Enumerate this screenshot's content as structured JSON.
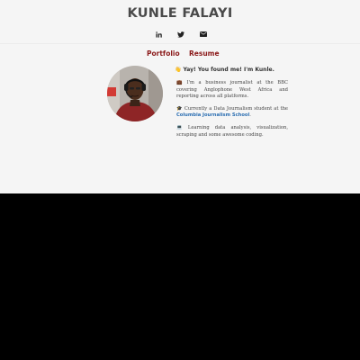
{
  "header": {
    "title": "KUNLE FALAYI"
  },
  "social": [
    {
      "icon": "linkedin-icon"
    },
    {
      "icon": "twitter-icon"
    },
    {
      "icon": "envelope-icon"
    }
  ],
  "nav": {
    "portfolio_label": "Portfolio",
    "resume_label": "Resume"
  },
  "bio": {
    "heading_emoji": "👋",
    "heading": "Yay! You found me! I'm Kunle.",
    "p1_emoji": "💼",
    "p1": "I'm a business journalist at the BBC covering Anglophone West Africa and reporting across all platforms.",
    "p2_emoji": "🎓",
    "p2_text": "Currently a Data Journalism student at the ",
    "p2_link": "Columbia Journalism School",
    "p2_end": ".",
    "p3_emoji": "💻",
    "p3": "Learning data analysis, visualization, scraping and some awesome coding."
  },
  "colors": {
    "nav_link": "#8b1a1a",
    "bio_link": "#2c6fb2",
    "page_bg": "#f5f5f5"
  }
}
